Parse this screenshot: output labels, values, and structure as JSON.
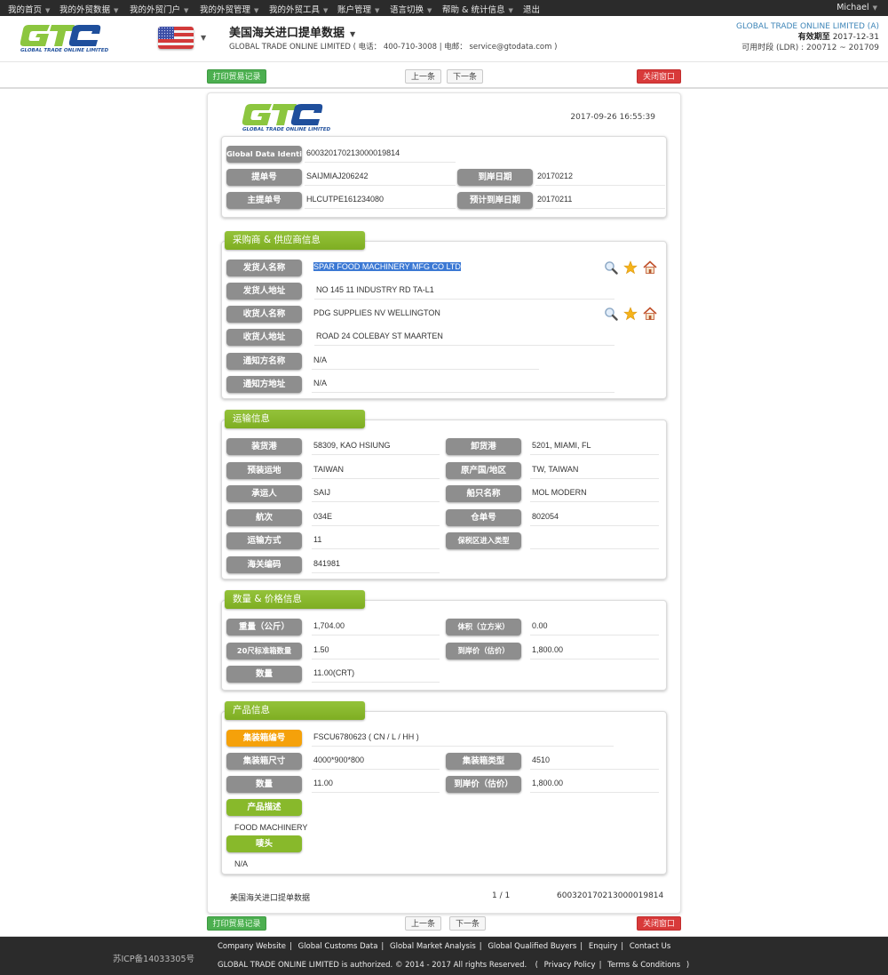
{
  "topnav": {
    "items": [
      "我的首页",
      "我的外贸数据",
      "我的外贸门户",
      "我的外贸管理",
      "我的外贸工具",
      "账户管理",
      "语言切换",
      "帮助 & 统计信息",
      "退出"
    ],
    "user": "Michael"
  },
  "header": {
    "logo_text": "GTC",
    "logo_tagline": "GLOBAL TRADE ONLINE LIMITED",
    "flag": "us-flag",
    "title": "美国海关进口提单数据",
    "subtitle": "GLOBAL TRADE ONLINE LIMITED ( 电话： 400-710-3008 | 电邮： service@gtodata.com )",
    "company": "GLOBAL TRADE ONLINE LIMITED (A)",
    "valid_label": "有效期至",
    "valid_date": "2017-12-31",
    "ldr": "可用时段 (LDR) : 200712 ~ 201709"
  },
  "actions": {
    "print": "打印贸易记录",
    "prev": "上一条",
    "next": "下一条",
    "close": "关闭窗口"
  },
  "record": {
    "timestamp": "2017-09-26 16:55:39",
    "ids": {
      "gdi_label": "Global Data Identity",
      "gdi": "600320170213000019814",
      "bol_label": "提单号",
      "bol": "SAIJMIAJ206242",
      "arrival_label": "到岸日期",
      "arrival": "20170212",
      "master_label": "主提单号",
      "master": "HLCUTPE161234080",
      "est_arrival_label": "预计到岸日期",
      "est_arrival": "20170211"
    },
    "parties": {
      "title": "采购商 & 供应商信息",
      "shipper_name_label": "发货人名称",
      "shipper_name": "SPAR FOOD MACHINERY MFG CO LTD",
      "shipper_addr_label": "发货人地址",
      "shipper_addr": "NO 145 11 INDUSTRY RD TA-L1",
      "consignee_name_label": "收货人名称",
      "consignee_name": "PDG SUPPLIES NV WELLINGTON",
      "consignee_addr_label": "收货人地址",
      "consignee_addr": "ROAD 24 COLEBAY ST MAARTEN",
      "notify_name_label": "通知方名称",
      "notify_name": "N/A",
      "notify_addr_label": "通知方地址",
      "notify_addr": "N/A"
    },
    "transport": {
      "title": "运输信息",
      "rows": [
        {
          "l1": "装货港",
          "v1": "58309, KAO HSIUNG",
          "l2": "卸货港",
          "v2": "5201, MIAMI, FL"
        },
        {
          "l1": "预装运地",
          "v1": "TAIWAN",
          "l2": "原产国/地区",
          "v2": "TW, TAIWAN"
        },
        {
          "l1": "承运人",
          "v1": "SAIJ",
          "l2": "船只名称",
          "v2": "MOL MODERN"
        },
        {
          "l1": "航次",
          "v1": "034E",
          "l2": "仓单号",
          "v2": "802054"
        },
        {
          "l1": "运输方式",
          "v1": "11",
          "l2": "保税区进入类型",
          "v2": ""
        },
        {
          "l1": "海关编码",
          "v1": "841981"
        }
      ]
    },
    "quantity": {
      "title": "数量 & 价格信息",
      "rows": [
        {
          "l1": "重量（公斤）",
          "v1": "1,704.00",
          "l2": "体积（立方米）",
          "v2": "0.00"
        },
        {
          "l1": "20尺标准箱数量",
          "v1": "1.50",
          "l2": "到岸价（估价）",
          "v2": "1,800.00"
        },
        {
          "l1": "数量",
          "v1": "11.00(CRT)"
        }
      ]
    },
    "product": {
      "title": "产品信息",
      "container_no_label": "集装箱编号",
      "container_no": "FSCU6780623 ( CN / L / HH )",
      "container_size_label": "集装箱尺寸",
      "container_size": "4000*900*800",
      "container_type_label": "集装箱类型",
      "container_type": "4510",
      "qty_label": "数量",
      "qty": "11.00",
      "price_label": "到岸价（估价）",
      "price": "1,800.00",
      "desc_label": "产品描述",
      "desc": "FOOD MACHINERY",
      "marks_label": "唛头",
      "marks": "N/A"
    },
    "footer": {
      "source": "美国海关进口提单数据",
      "page": "1 / 1",
      "id": "600320170213000019814"
    }
  },
  "footer": {
    "icp": "苏ICP备14033305号",
    "links": [
      "Company Website",
      "Global Customs Data",
      "Global Market Analysis",
      "Global Qualified Buyers",
      "Enquiry",
      "Contact Us"
    ],
    "copyright": "GLOBAL TRADE ONLINE LIMITED is authorized. © 2014 - 2017 All rights Reserved.",
    "policy_links": [
      "Privacy Policy",
      "Terms & Conditions"
    ]
  },
  "colors": {
    "accent_green": "#88b92b",
    "label_gray": "#8e8e8e",
    "highlight_orange": "#f5a10a",
    "print_green": "#4caf50",
    "close_red": "#d83a3a",
    "company_blue": "#3f86b8"
  }
}
